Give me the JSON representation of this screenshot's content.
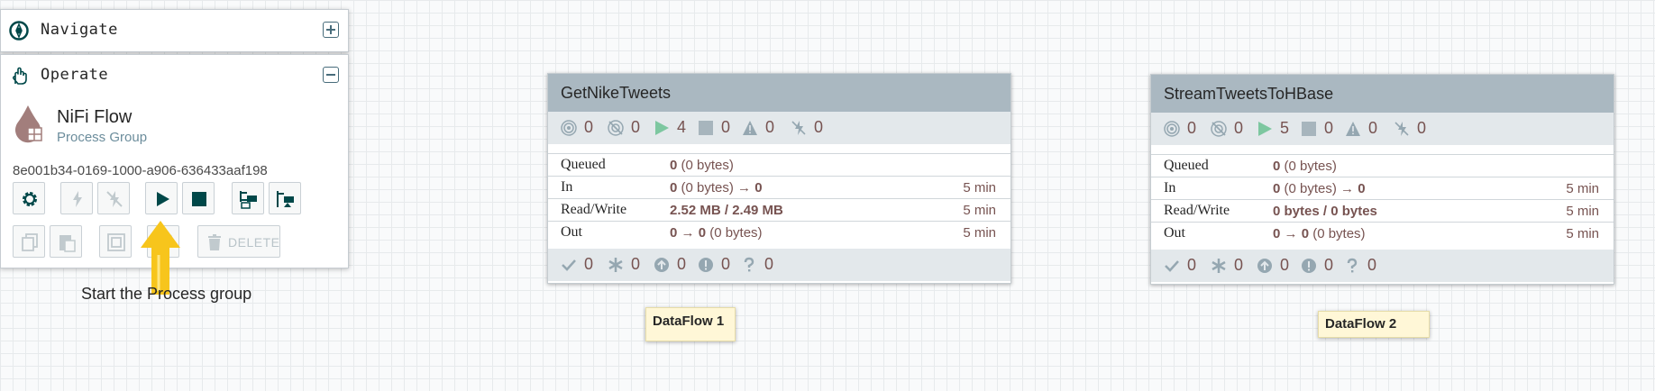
{
  "navigate_panel": {
    "title": "Navigate"
  },
  "operate_panel": {
    "title": "Operate",
    "flow_name": "NiFi Flow",
    "flow_type": "Process Group",
    "flow_id": "8e001b34-0169-1000-a906-636433aaf198",
    "delete_label": "DELETE"
  },
  "annotation": {
    "text": "Start the Process group",
    "arrow_color": "#f7c51c"
  },
  "process_groups": [
    {
      "name": "GetNikeTweets",
      "stats": {
        "transmitting": "0",
        "not_transmitting": "0",
        "running": "4",
        "stopped": "0",
        "invalid": "0",
        "disabled": "0"
      },
      "queued_label": "Queued",
      "queued_count": "0",
      "queued_bytes": " (0 bytes)",
      "in_label": "In",
      "in_count": "0",
      "in_bytes": " (0 bytes) → ",
      "in_out": "0",
      "in_time": "5 min",
      "rw_label": "Read/Write",
      "rw_value": "2.52 MB / 2.49 MB",
      "rw_time": "5 min",
      "out_label": "Out",
      "out_a": "0",
      "out_arrow": " → ",
      "out_b": "0",
      "out_bytes": " (0 bytes)",
      "out_time": "5 min",
      "footer": {
        "up_to_date": "0",
        "locally_modified": "0",
        "stale": "0",
        "modified_stale": "0",
        "sync_failure": "0"
      }
    },
    {
      "name": "StreamTweetsToHBase",
      "stats": {
        "transmitting": "0",
        "not_transmitting": "0",
        "running": "5",
        "stopped": "0",
        "invalid": "0",
        "disabled": "0"
      },
      "queued_label": "Queued",
      "queued_count": "0",
      "queued_bytes": " (0 bytes)",
      "in_label": "In",
      "in_count": "0",
      "in_bytes": " (0 bytes) → ",
      "in_out": "0",
      "in_time": "5 min",
      "rw_label": "Read/Write",
      "rw_value": "0 bytes / 0 bytes",
      "rw_time": "5 min",
      "out_label": "Out",
      "out_a": "0",
      "out_arrow": " → ",
      "out_b": "0",
      "out_bytes": " (0 bytes)",
      "out_time": "5 min",
      "footer": {
        "up_to_date": "0",
        "locally_modified": "0",
        "stale": "0",
        "modified_stale": "0",
        "sync_failure": "0"
      }
    }
  ],
  "labels": [
    {
      "text": "DataFlow 1"
    },
    {
      "text": "DataFlow 2"
    }
  ],
  "colors": {
    "accent": "#004849",
    "title_bar": "#aab8c1",
    "stats_bar": "#e3e8eb",
    "running": "#7dc7a0",
    "value_text": "#775351",
    "label_bg": "#fff7d7"
  }
}
